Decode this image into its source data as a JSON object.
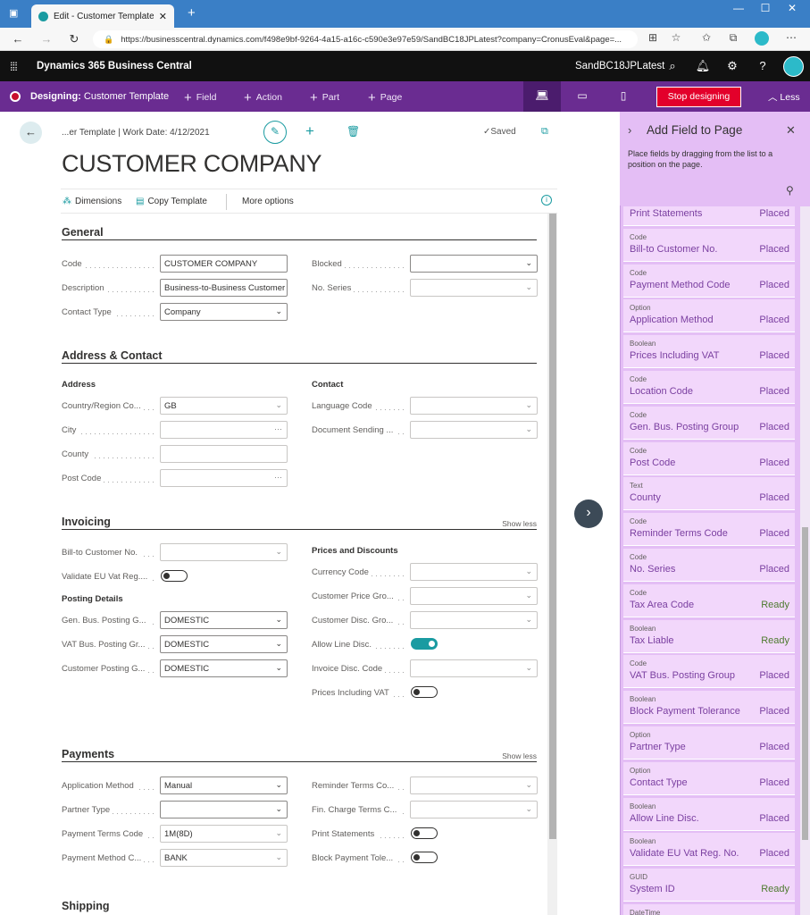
{
  "browser": {
    "tab_title": "Edit - Customer Template - Dyna",
    "url": "https://businesscentral.dynamics.com/f498e9bf-9264-4a15-a16c-c590e3e97e59/SandBC18JPLatest?company=CronusEval&page=..."
  },
  "app": {
    "name": "Dynamics 365 Business Central",
    "environment": "SandBC18JPLatest"
  },
  "designer": {
    "prefix": "Designing:",
    "target": "Customer Template",
    "actions": [
      "Field",
      "Action",
      "Part",
      "Page"
    ],
    "stop_label": "Stop designing",
    "less_label": "Less"
  },
  "page": {
    "breadcrumb": "...er Template | Work Date: 4/12/2021",
    "saved_label": "Saved",
    "title": "CUSTOMER COMPANY",
    "actions": {
      "dimensions": "Dimensions",
      "copy_template": "Copy Template",
      "more_options": "More options"
    }
  },
  "general": {
    "title": "General",
    "code_label": "Code",
    "code_value": "CUSTOMER COMPANY",
    "description_label": "Description",
    "description_value": "Business-to-Business Customer",
    "contact_type_label": "Contact Type",
    "contact_type_value": "Company",
    "blocked_label": "Blocked",
    "blocked_value": "",
    "no_series_label": "No. Series",
    "no_series_value": ""
  },
  "address": {
    "title": "Address & Contact",
    "address_sub": "Address",
    "contact_sub": "Contact",
    "country_label": "Country/Region Co...",
    "country_value": "GB",
    "city_label": "City",
    "county_label": "County",
    "post_code_label": "Post Code",
    "language_label": "Language Code",
    "doc_sending_label": "Document Sending ..."
  },
  "invoicing": {
    "title": "Invoicing",
    "show_less": "Show less",
    "bill_to_label": "Bill-to Customer No.",
    "validate_vat_label": "Validate EU Vat Reg....",
    "posting_details_sub": "Posting Details",
    "gen_bus_label": "Gen. Bus. Posting G...",
    "gen_bus_value": "DOMESTIC",
    "vat_bus_label": "VAT Bus. Posting Gr...",
    "vat_bus_value": "DOMESTIC",
    "cust_posting_label": "Customer Posting G...",
    "cust_posting_value": "DOMESTIC",
    "prices_sub": "Prices and Discounts",
    "currency_label": "Currency Code",
    "cust_price_label": "Customer Price Gro...",
    "cust_disc_label": "Customer Disc. Gro...",
    "allow_line_label": "Allow Line Disc.",
    "invoice_disc_label": "Invoice Disc. Code",
    "prices_incl_vat_label": "Prices Including VAT"
  },
  "payments": {
    "title": "Payments",
    "show_less": "Show less",
    "app_method_label": "Application Method",
    "app_method_value": "Manual",
    "partner_type_label": "Partner Type",
    "partner_type_value": "",
    "pay_terms_label": "Payment Terms Code",
    "pay_terms_value": "1M(8D)",
    "pay_method_label": "Payment Method C...",
    "pay_method_value": "BANK",
    "reminder_label": "Reminder Terms Co...",
    "fin_charge_label": "Fin. Charge Terms C...",
    "print_stmt_label": "Print Statements",
    "block_pay_label": "Block Payment Tole..."
  },
  "shipping": {
    "title": "Shipping"
  },
  "panel": {
    "title": "Add Field to Page",
    "hint": "Place fields by dragging from the list to a position on the page.",
    "fields": [
      {
        "type": "",
        "name": "Print Statements",
        "status": "Placed"
      },
      {
        "type": "Code",
        "name": "Bill-to Customer No.",
        "status": "Placed"
      },
      {
        "type": "Code",
        "name": "Payment Method Code",
        "status": "Placed"
      },
      {
        "type": "Option",
        "name": "Application Method",
        "status": "Placed"
      },
      {
        "type": "Boolean",
        "name": "Prices Including VAT",
        "status": "Placed"
      },
      {
        "type": "Code",
        "name": "Location Code",
        "status": "Placed"
      },
      {
        "type": "Code",
        "name": "Gen. Bus. Posting Group",
        "status": "Placed"
      },
      {
        "type": "Code",
        "name": "Post Code",
        "status": "Placed"
      },
      {
        "type": "Text",
        "name": "County",
        "status": "Placed"
      },
      {
        "type": "Code",
        "name": "Reminder Terms Code",
        "status": "Placed"
      },
      {
        "type": "Code",
        "name": "No. Series",
        "status": "Placed"
      },
      {
        "type": "Code",
        "name": "Tax Area Code",
        "status": "Ready"
      },
      {
        "type": "Boolean",
        "name": "Tax Liable",
        "status": "Ready"
      },
      {
        "type": "Code",
        "name": "VAT Bus. Posting Group",
        "status": "Placed"
      },
      {
        "type": "Boolean",
        "name": "Block Payment Tolerance",
        "status": "Placed"
      },
      {
        "type": "Option",
        "name": "Partner Type",
        "status": "Placed"
      },
      {
        "type": "Option",
        "name": "Contact Type",
        "status": "Placed"
      },
      {
        "type": "Boolean",
        "name": "Allow Line Disc.",
        "status": "Placed"
      },
      {
        "type": "Boolean",
        "name": "Validate EU Vat Reg. No.",
        "status": "Placed"
      },
      {
        "type": "GUID",
        "name": "System ID",
        "status": "Ready"
      },
      {
        "type": "DateTime",
        "name": "",
        "status": ""
      }
    ]
  },
  "colors": {
    "accent": "#1a9ba1",
    "designer_bar": "#6a2c91",
    "stop": "#e3002b",
    "panel": "#e4bef5"
  }
}
